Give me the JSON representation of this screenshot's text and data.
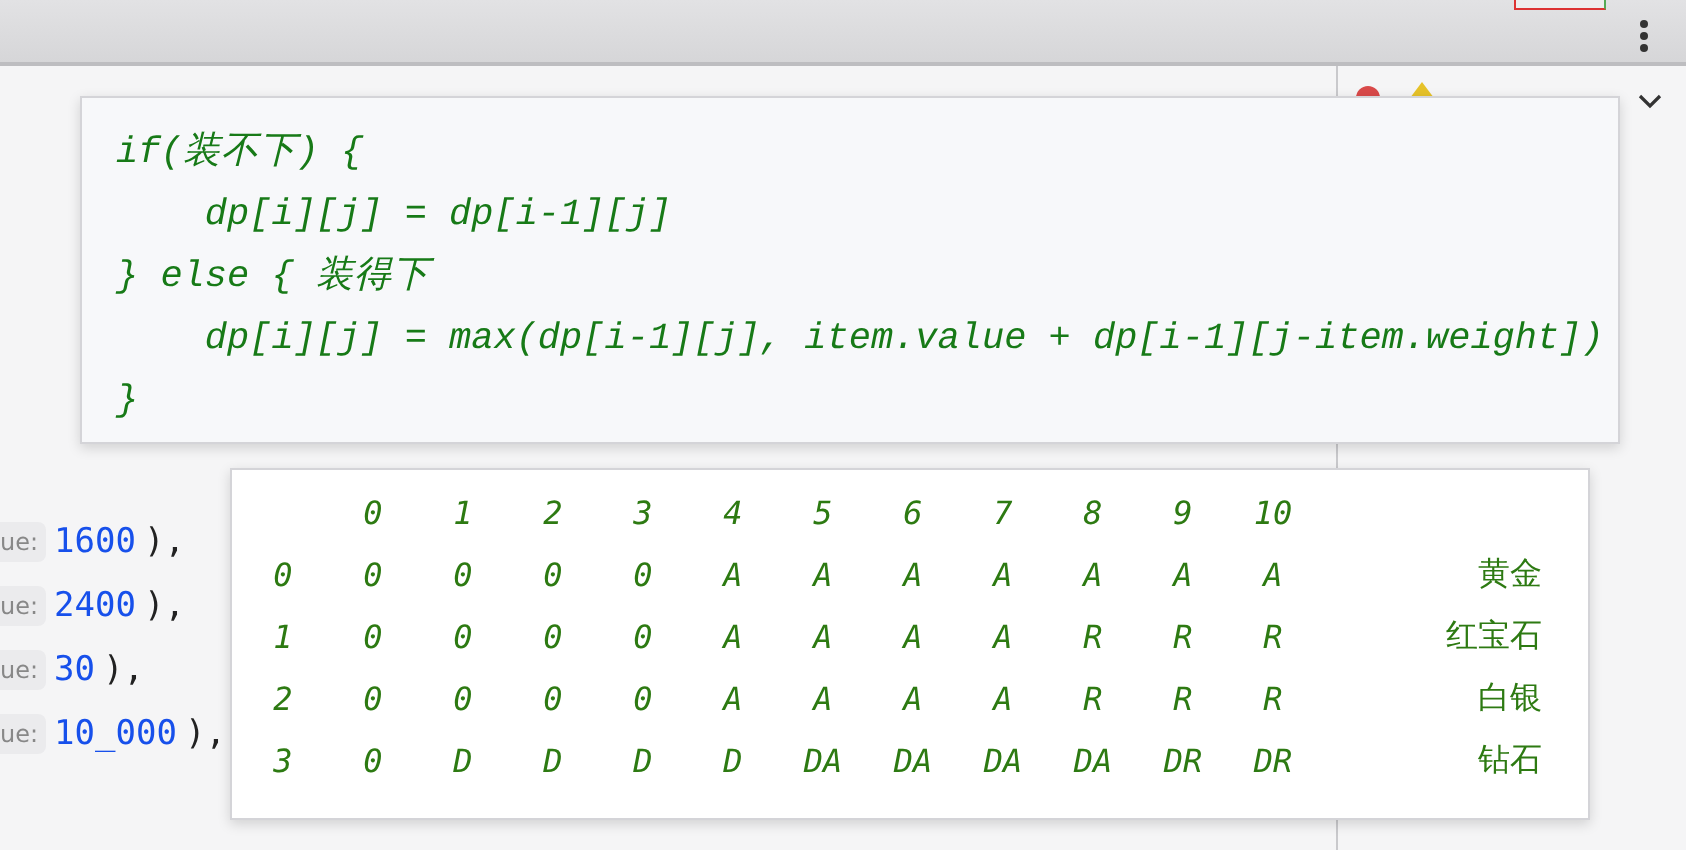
{
  "code_popup": {
    "lines": [
      "if(装不下) {",
      "    dp[i][j] = dp[i-1][j]",
      "} else { 装得下",
      "    dp[i][j] = max(dp[i-1][j], item.value + dp[i-1][j-item.weight])",
      "}"
    ]
  },
  "editor_lines": [
    {
      "hint": "ue:",
      "value": "1600",
      "suffix": "),"
    },
    {
      "hint": "ue:",
      "value": "2400",
      "suffix": "),"
    },
    {
      "hint": "ue:",
      "value": "30",
      "suffix": "),"
    },
    {
      "hint": "ue:",
      "value": "10_000",
      "suffix": "),"
    }
  ],
  "table_popup": {
    "columns": [
      "0",
      "1",
      "2",
      "3",
      "4",
      "5",
      "6",
      "7",
      "8",
      "9",
      "10"
    ],
    "rows": [
      {
        "index": "0",
        "cells": [
          "0",
          "0",
          "0",
          "0",
          "A",
          "A",
          "A",
          "A",
          "A",
          "A",
          "A"
        ],
        "item": "黄金"
      },
      {
        "index": "1",
        "cells": [
          "0",
          "0",
          "0",
          "0",
          "A",
          "A",
          "A",
          "A",
          "R",
          "R",
          "R"
        ],
        "item": "红宝石"
      },
      {
        "index": "2",
        "cells": [
          "0",
          "0",
          "0",
          "0",
          "A",
          "A",
          "A",
          "A",
          "R",
          "R",
          "R"
        ],
        "item": "白银"
      },
      {
        "index": "3",
        "cells": [
          "0",
          "D",
          "D",
          "D",
          "D",
          "DA",
          "DA",
          "DA",
          "DA",
          "DR",
          "DR"
        ],
        "item": "钻石"
      }
    ]
  }
}
